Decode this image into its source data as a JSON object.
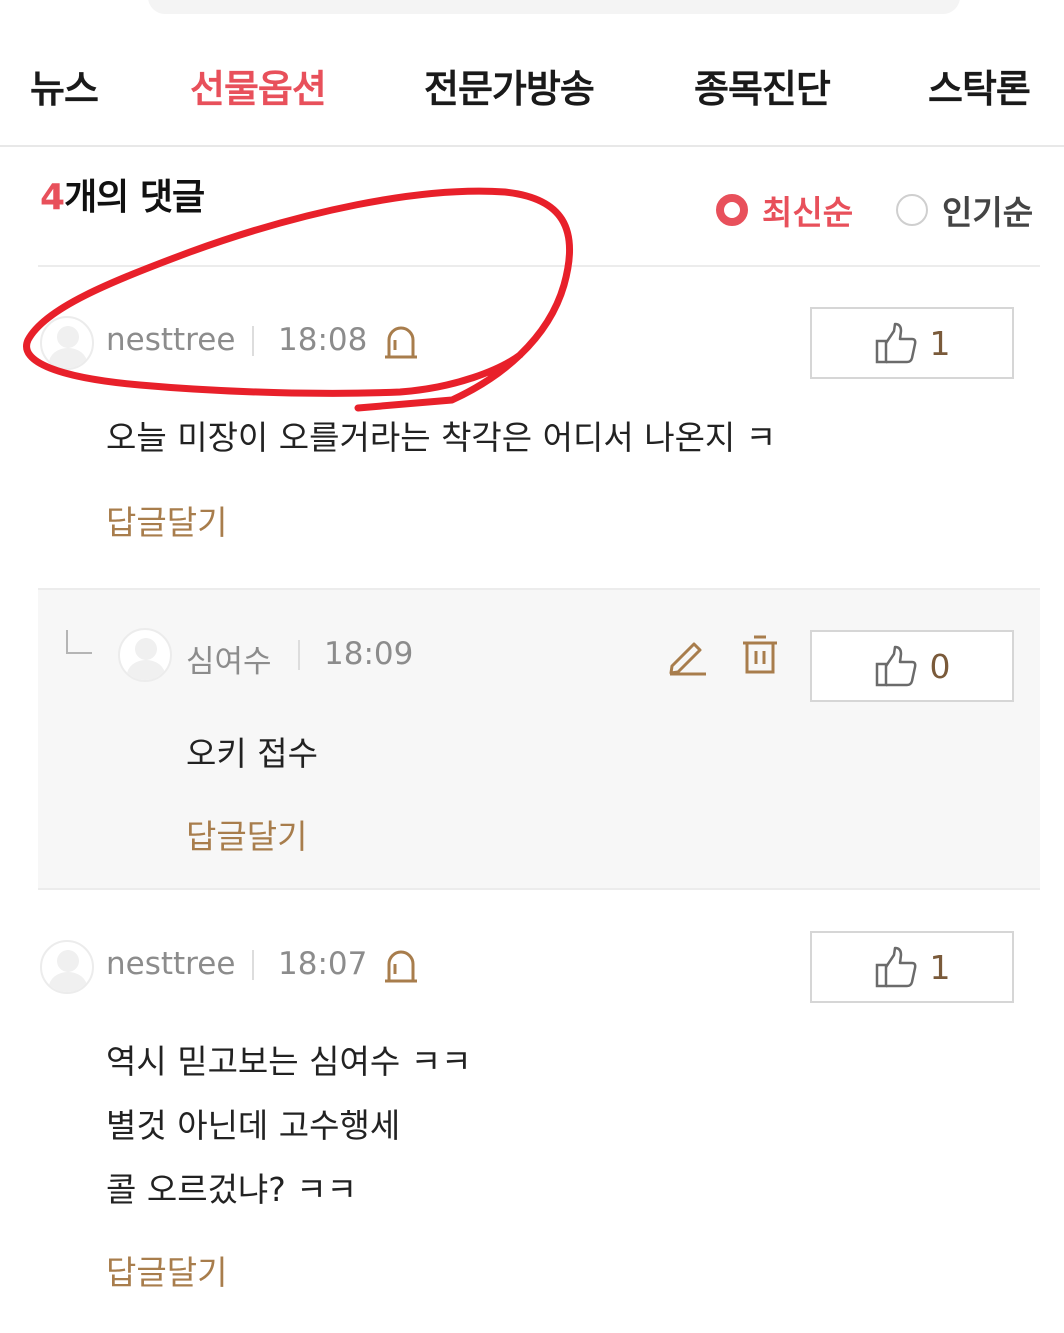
{
  "nav": {
    "items": [
      {
        "label": "뉴스",
        "active": false
      },
      {
        "label": "선물옵션",
        "active": true
      },
      {
        "label": "전문가방송",
        "active": false
      },
      {
        "label": "종목진단",
        "active": false
      },
      {
        "label": "스탁론",
        "active": false
      }
    ]
  },
  "comments_header": {
    "count": "4",
    "count_suffix": "개의 댓글",
    "sort_latest": "최신순",
    "sort_popular": "인기순",
    "selected_sort": "최신순"
  },
  "comments": [
    {
      "author": "nesttree",
      "time": "18:08",
      "likes": "1",
      "text": "오늘 미장이 오를거라는 착각은 어디서 나온지 ㅋ",
      "reply_label": "답글달기"
    },
    {
      "author": "심여수",
      "time": "18:09",
      "likes": "0",
      "text": "오키 접수",
      "reply_label": "답글달기"
    },
    {
      "author": "nesttree",
      "time": "18:07",
      "likes": "1",
      "lines": [
        "역시 믿고보는 심여수 ㅋㅋ",
        "별것 아닌데 고수행세",
        "콜 오르겄냐? ㅋㅋ"
      ],
      "reply_label": "답글달기"
    }
  ],
  "colors": {
    "accent": "#e8505b",
    "reply_link": "#a87d4c",
    "annotation": "#e8202a"
  }
}
